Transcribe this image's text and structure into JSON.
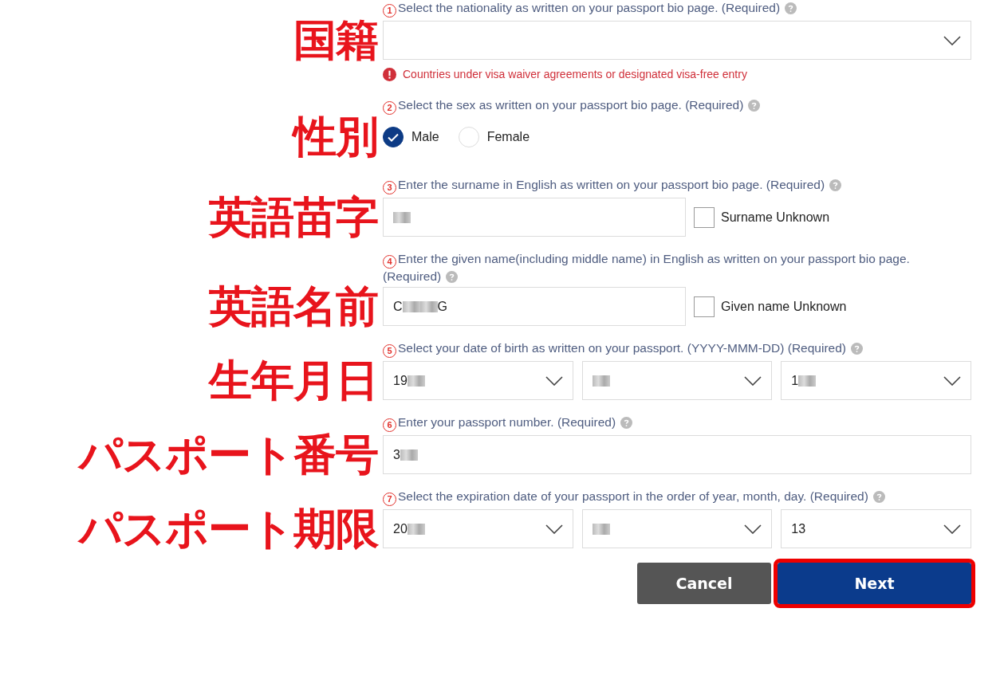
{
  "fields": [
    {
      "side_label": "国籍",
      "number": "1",
      "question": "Select the nationality as written on your passport bio page. (Required)",
      "kind": "select",
      "error": "Countries under visa waiver agreements or designated visa-free entry"
    },
    {
      "side_label": "性別",
      "number": "2",
      "question": "Select the sex as written on your passport bio page. (Required)",
      "kind": "radio",
      "options": [
        {
          "label": "Male",
          "selected": true
        },
        {
          "label": "Female",
          "selected": false
        }
      ]
    },
    {
      "side_label": "英語苗字",
      "number": "3",
      "question": "Enter the surname in English as written on your passport bio page. (Required)",
      "kind": "text_with_checkbox",
      "parts": [
        {
          "blurred": true
        }
      ],
      "checkbox": {
        "label": "Surname Unknown",
        "checked": false
      }
    },
    {
      "side_label": "英語名前",
      "number": "4",
      "question": "Enter the given name(including middle name) in English as written on your passport bio page. (Required)",
      "kind": "text_with_checkbox",
      "parts": [
        {
          "value": "C",
          "blurred": true
        },
        {
          "blurred": true
        },
        {
          "value": "G",
          "blurred": false
        }
      ],
      "checkbox": {
        "label": "Given name Unknown",
        "checked": false
      }
    },
    {
      "side_label": "生年月日",
      "number": "5",
      "question": "Select your date of birth as written on your passport. (YYYY-MMM-DD) (Required)",
      "kind": "date",
      "selects": [
        {
          "value": "19",
          "blurred": true
        },
        {
          "blurred": true
        },
        {
          "value": "1",
          "blurred": true
        }
      ]
    },
    {
      "side_label": "パスポート番号",
      "number": "6",
      "question": "Enter your passport number. (Required)",
      "kind": "text",
      "parts": [
        {
          "value": "3",
          "blurred": true
        }
      ]
    },
    {
      "side_label": "パスポート期限",
      "number": "7",
      "question": "Select the expiration date of your passport in the order of year, month, day. (Required)",
      "kind": "date",
      "selects": [
        {
          "value": "20",
          "blurred": true
        },
        {
          "blurred": true
        },
        {
          "value": "13",
          "blurred": false
        }
      ]
    }
  ],
  "buttons": [
    {
      "label": "Cancel",
      "kind": "secondary",
      "highlighted": false
    },
    {
      "label": "Next",
      "kind": "primary",
      "highlighted": true
    }
  ]
}
